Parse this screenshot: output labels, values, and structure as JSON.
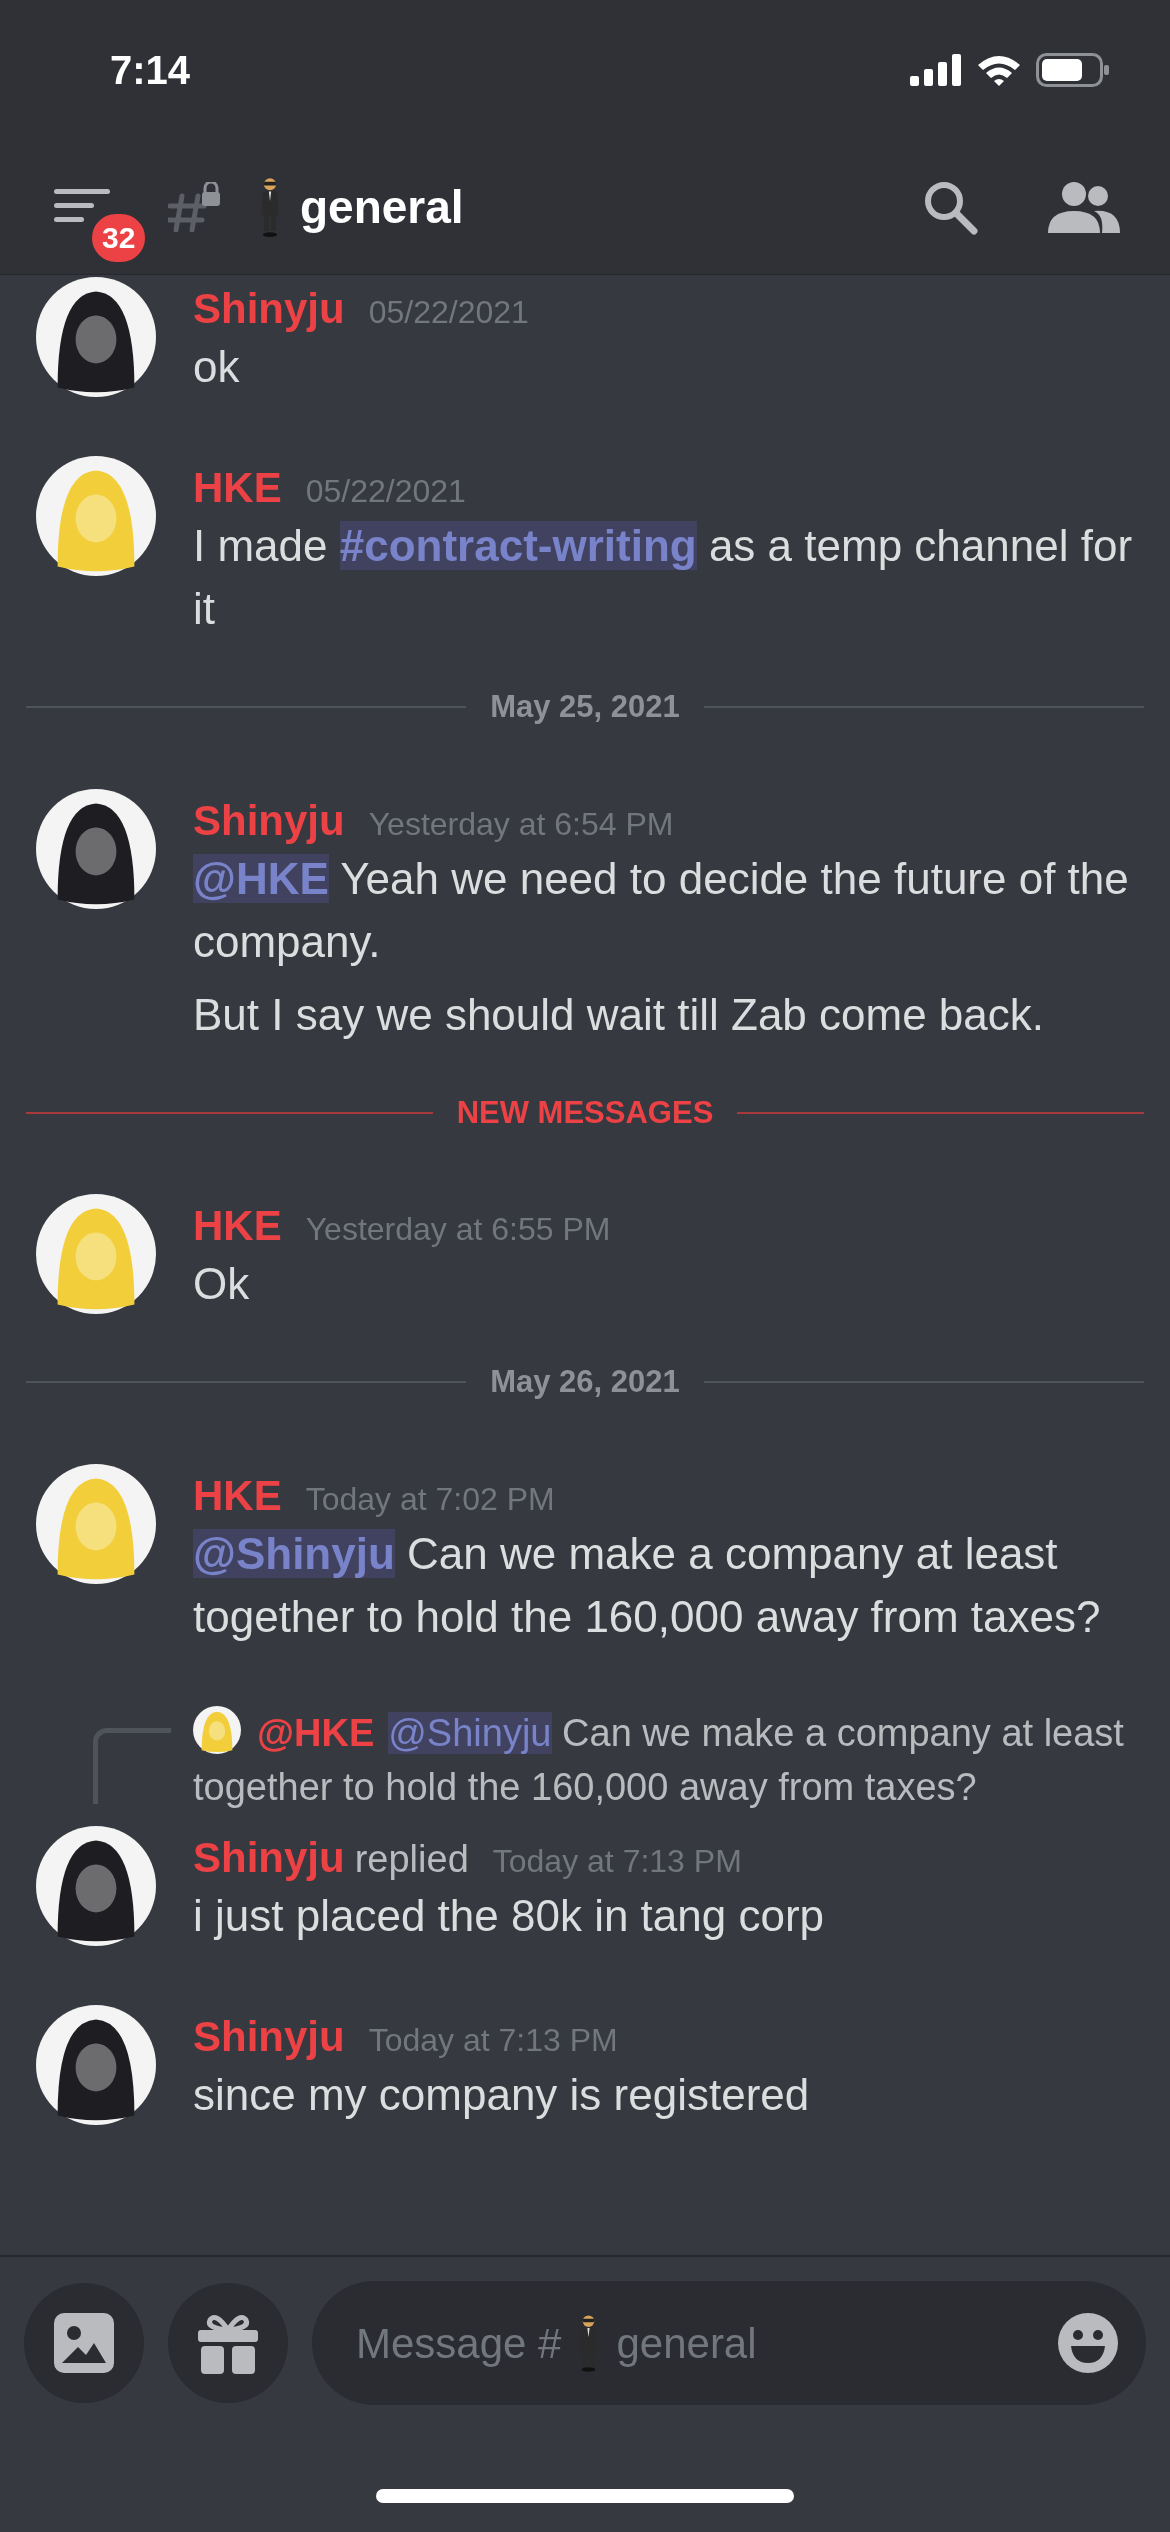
{
  "status_bar": {
    "time": "7:14"
  },
  "header": {
    "unread_badge": "32",
    "channel": "general"
  },
  "messages": [
    {
      "kind": "message",
      "color": "#1e1e22",
      "author": "Shinyju",
      "timestamp": "05/22/2021",
      "lines": [
        [
          {
            "kind": "text",
            "text": "ok"
          }
        ]
      ]
    },
    {
      "kind": "message",
      "color": "#f2cf3a",
      "author": "HKE",
      "timestamp": "05/22/2021",
      "lines": [
        [
          {
            "kind": "text",
            "text": "I made "
          },
          {
            "kind": "mention",
            "text": "#contract-writing"
          },
          {
            "kind": "text",
            "text": " as a temp channel for it"
          }
        ]
      ]
    },
    {
      "kind": "divider",
      "label": "May 25, 2021",
      "new": false
    },
    {
      "kind": "message",
      "color": "#1e1e22",
      "author": "Shinyju",
      "timestamp": "Yesterday at 6:54 PM",
      "lines": [
        [
          {
            "kind": "mention",
            "text": "@HKE"
          },
          {
            "kind": "text",
            "text": " Yeah we need to decide the future of the company."
          }
        ],
        [
          {
            "kind": "text",
            "text": "But I say we should wait till Zab come back."
          }
        ]
      ]
    },
    {
      "kind": "divider",
      "label": "NEW MESSAGES",
      "new": true
    },
    {
      "kind": "message",
      "color": "#f2cf3a",
      "author": "HKE",
      "timestamp": "Yesterday at 6:55 PM",
      "lines": [
        [
          {
            "kind": "text",
            "text": "Ok"
          }
        ]
      ]
    },
    {
      "kind": "divider",
      "label": "May 26, 2021",
      "new": false
    },
    {
      "kind": "message",
      "color": "#f2cf3a",
      "author": "HKE",
      "timestamp": "Today at 7:02 PM",
      "lines": [
        [
          {
            "kind": "mention",
            "text": "@Shinyju"
          },
          {
            "kind": "text",
            "text": " Can we make a company at least together to hold the 160,000 away from taxes?"
          }
        ]
      ]
    },
    {
      "kind": "message",
      "color": "#1e1e22",
      "author": "Shinyju",
      "replied_label": "replied",
      "reply_to": {
        "color": "#f2cf3a",
        "author": "@HKE",
        "mention": "@Shinyju",
        "text": "Can we make a company at least together to hold the 160,000 away from taxes?"
      },
      "timestamp": "Today at 7:13 PM",
      "lines": [
        [
          {
            "kind": "text",
            "text": "i just placed the 80k in tang corp"
          }
        ]
      ]
    },
    {
      "kind": "message",
      "color": "#1e1e22",
      "author": "Shinyju",
      "timestamp": "Today at 7:13 PM",
      "lines": [
        [
          {
            "kind": "text",
            "text": "since my company is registered"
          }
        ]
      ]
    }
  ],
  "composer": {
    "placeholder_prefix": "Message #",
    "channel": "general"
  }
}
